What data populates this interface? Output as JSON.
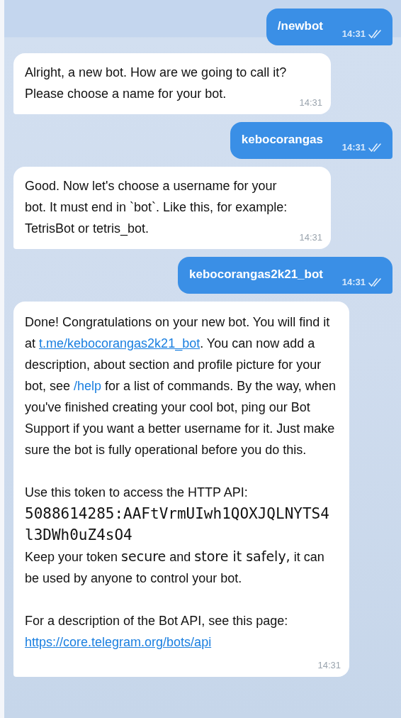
{
  "messages": [
    {
      "kind": "out",
      "text": "/newbot",
      "time": "14:31",
      "read": true
    },
    {
      "kind": "in",
      "text": "Alright, a new bot. How are we going to call it? Please choose a name for your bot.",
      "time": "14:31"
    },
    {
      "kind": "out",
      "text": "kebocorangas",
      "time": "14:31",
      "read": true
    },
    {
      "kind": "in",
      "text": "Good. Now let's choose a username for your bot. It must end in `bot`. Like this, for example: TetrisBot or tetris_bot.",
      "time": "14:31"
    },
    {
      "kind": "out",
      "text": "kebocorangas2k21_bot",
      "time": "14:31",
      "read": true
    },
    {
      "kind": "rich",
      "time": "14:31",
      "blocks": [
        {
          "kind": "text",
          "runs": [
            {
              "kind": "text",
              "text": "Done! Congratulations on your new bot. You will find it at "
            },
            {
              "kind": "link",
              "text": "t.me/kebocorangas2k21_bot"
            },
            {
              "kind": "text",
              "text": ". You can now add a description, about section and profile picture for your bot, see "
            },
            {
              "kind": "command",
              "text": "/help"
            },
            {
              "kind": "text",
              "text": " for a list of commands. By the way, when you've finished creating your cool bot, ping our Bot Support if you want a better username for it. Just make sure the bot is fully operational before you do this."
            }
          ]
        },
        {
          "kind": "gap"
        },
        {
          "kind": "text",
          "runs": [
            {
              "kind": "text",
              "text": "Use this token to access the HTTP API:"
            }
          ]
        },
        {
          "kind": "code",
          "text": "5088614285:AAFtVrmUIwh1QOXJQLNYTS4l3DWh0uZ4sO4"
        },
        {
          "kind": "text",
          "runs": [
            {
              "kind": "text",
              "text": "Keep your token "
            },
            {
              "kind": "big",
              "text": "secure"
            },
            {
              "kind": "text",
              "text": " and "
            },
            {
              "kind": "big",
              "text": "store it safely,"
            },
            {
              "kind": "text",
              "text": " it can be used by anyone to control your bot."
            }
          ]
        },
        {
          "kind": "gap"
        },
        {
          "kind": "text",
          "runs": [
            {
              "kind": "text",
              "text": "For a description of the Bot API, see this page: "
            },
            {
              "kind": "link",
              "text": "https://core.telegram.org/bots/api"
            }
          ]
        }
      ]
    }
  ]
}
